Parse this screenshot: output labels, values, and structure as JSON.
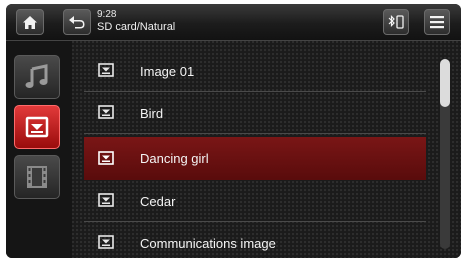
{
  "status": {
    "time": "9:28",
    "path": "SD card/Natural"
  },
  "toolbar": {
    "home_icon": "home-icon",
    "back_icon": "back-icon",
    "bluetooth_icon": "bluetooth-icon",
    "menu_icon": "menu-icon"
  },
  "sidebar": {
    "items": [
      {
        "name": "music",
        "icon": "music-note-icon",
        "active": false
      },
      {
        "name": "photos",
        "icon": "photo-icon",
        "active": true
      },
      {
        "name": "videos",
        "icon": "film-icon",
        "active": false
      }
    ]
  },
  "list": {
    "items": [
      {
        "label": "Image 01",
        "selected": false
      },
      {
        "label": "Bird",
        "selected": false
      },
      {
        "label": "Dancing girl",
        "selected": true
      },
      {
        "label": "Cedar",
        "selected": false
      },
      {
        "label": "Communications image",
        "selected": false
      }
    ]
  },
  "colors": {
    "accent": "#c41e1e",
    "selected_row": "#6a1010",
    "background": "#1b1b1b"
  }
}
